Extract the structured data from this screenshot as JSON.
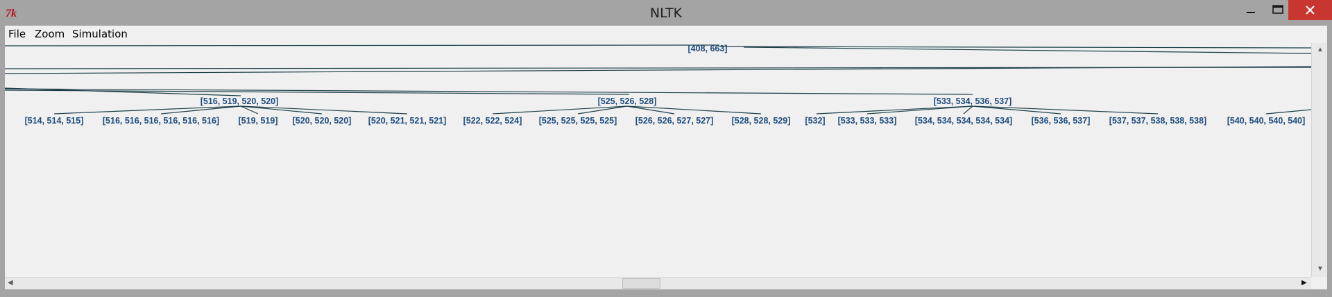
{
  "window": {
    "title": "NLTK",
    "icon": "tk-feather-icon"
  },
  "menu": {
    "file": "File",
    "zoom": "Zoom",
    "simulation": "Simulation"
  },
  "tree": {
    "root": "[408, 663]",
    "groups": [
      {
        "label": "[516, 519, 520, 520]",
        "children": [
          "[514, 514, 515]",
          "[516, 516, 516, 516, 516, 516]",
          "[519, 519]",
          "[520, 520, 520]",
          "[520, 521, 521, 521]"
        ]
      },
      {
        "label": "[525, 526, 528]",
        "children": [
          "[522, 522, 524]",
          "[525, 525, 525, 525]",
          "[526, 526, 527, 527]",
          "[528, 528, 529]"
        ]
      },
      {
        "label": "[533, 534, 536, 537]",
        "children": [
          "[532]",
          "[533, 533, 533]",
          "[534, 534, 534, 534, 534]",
          "[536, 536, 537]",
          "[537, 537, 538, 538, 538]"
        ]
      }
    ],
    "extra_leaf": "[540, 540, 540, 540]"
  },
  "colors": {
    "node_text": "#1f4d7f",
    "edge": "#1c3f47",
    "close_button": "#c7372f"
  }
}
